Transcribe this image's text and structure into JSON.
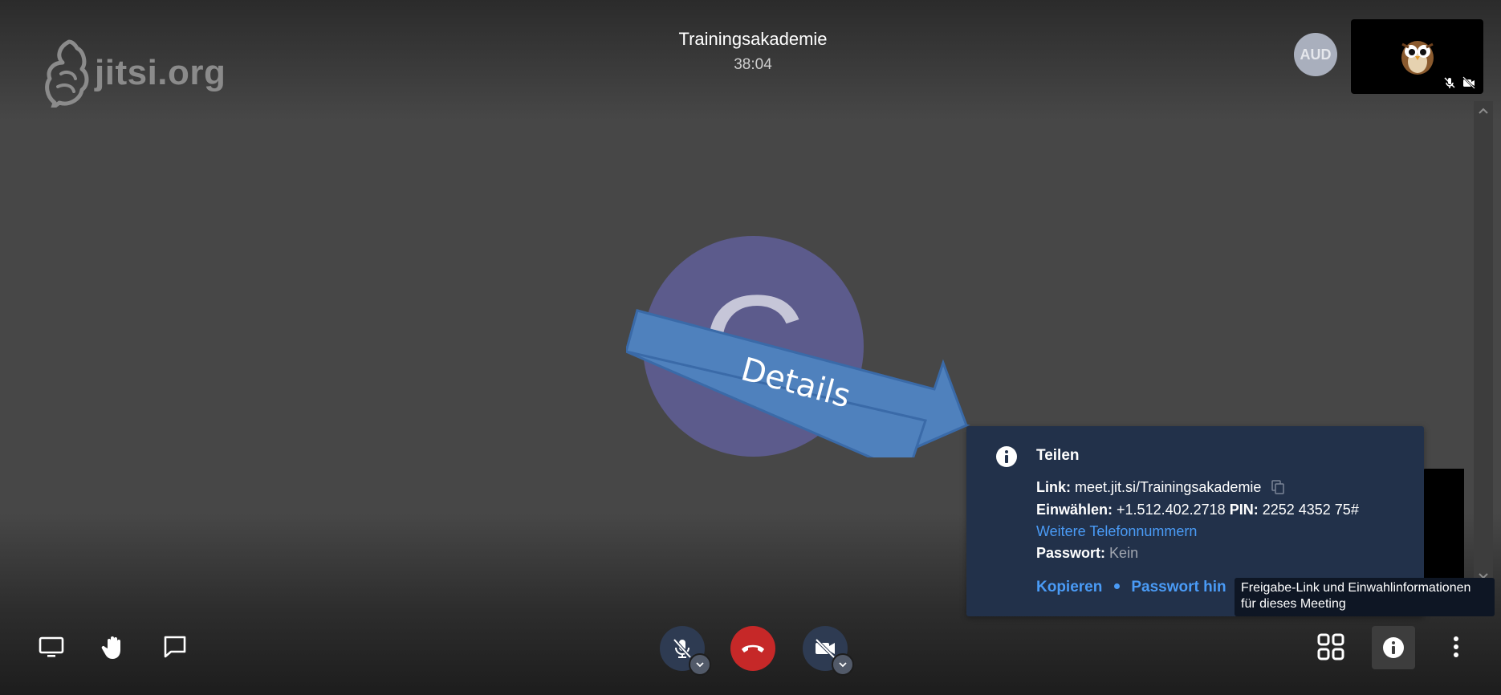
{
  "logo": {
    "text": "jitsi.org",
    "icon": "jitsi-logo-icon"
  },
  "header": {
    "title": "Trainingsakademie",
    "timer": "38:04"
  },
  "filmstrip": {
    "participant_avatar": "AUD",
    "self_view_icons": [
      "muted-mic-icon",
      "camera-off-icon"
    ]
  },
  "stage": {
    "avatar_letter": "C"
  },
  "annotation": {
    "arrow_label": "Details"
  },
  "share_popup": {
    "title": "Teilen",
    "link_label": "Link:",
    "link_value": "meet.jit.si/Trainingsakademie",
    "dial_label": "Einwählen:",
    "dial_number": "+1.512.402.2718",
    "pin_label": "PIN:",
    "pin_value": "2252 4352 75#",
    "more_numbers": "Weitere Telefonnummern",
    "password_label": "Passwort:",
    "password_value": "Kein",
    "copy_action": "Kopieren",
    "password_action": "Passwort hin"
  },
  "tooltip": {
    "line1": "Freigabe-Link und Einwahlinformationen",
    "line2": "für dieses Meeting"
  },
  "toolbar": {
    "left": [
      "desktop-share-icon",
      "raise-hand-icon",
      "chat-icon"
    ],
    "center": [
      "mic-muted-icon",
      "hangup-icon",
      "camera-off-icon"
    ],
    "right": [
      "tile-view-icon",
      "info-icon",
      "more-options-icon"
    ]
  },
  "colors": {
    "hangup": "#c62828",
    "popup_bg": "#22314a",
    "link_blue": "#4a9bf6",
    "avatar": "#5c5b8c",
    "arrow": "#4f81bd"
  }
}
